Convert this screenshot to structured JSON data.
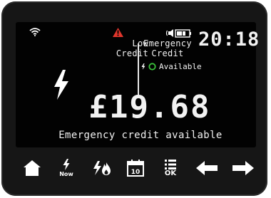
{
  "status": {
    "low_credit_line1": "Low",
    "low_credit_line2": "Credit",
    "emergency_line1": "Emergency",
    "emergency_line2": "Credit",
    "emergency_status": "Available",
    "clock": "20:18"
  },
  "main": {
    "amount": "£19.68",
    "message": "Emergency credit available"
  },
  "buttons": {
    "now_label": "Now",
    "calendar_day": "10",
    "menu_label": "OK"
  },
  "icons": {
    "wifi": "wifi-icon",
    "warning": "warning-icon",
    "speaker": "speaker-icon",
    "battery": "battery-icon",
    "bolt": "lightning-bolt-icon",
    "ring": "status-ring-icon",
    "home": "home-icon",
    "electric_gas": "electric-gas-icon",
    "calendar": "calendar-icon",
    "menu": "menu-list-icon",
    "left": "arrow-left-icon",
    "right": "arrow-right-icon"
  },
  "colors": {
    "warning": "#e0362c",
    "ring": "#3cc43c",
    "screen_text": "#f2f2f2",
    "device": "#161616",
    "screen": "#020202"
  }
}
